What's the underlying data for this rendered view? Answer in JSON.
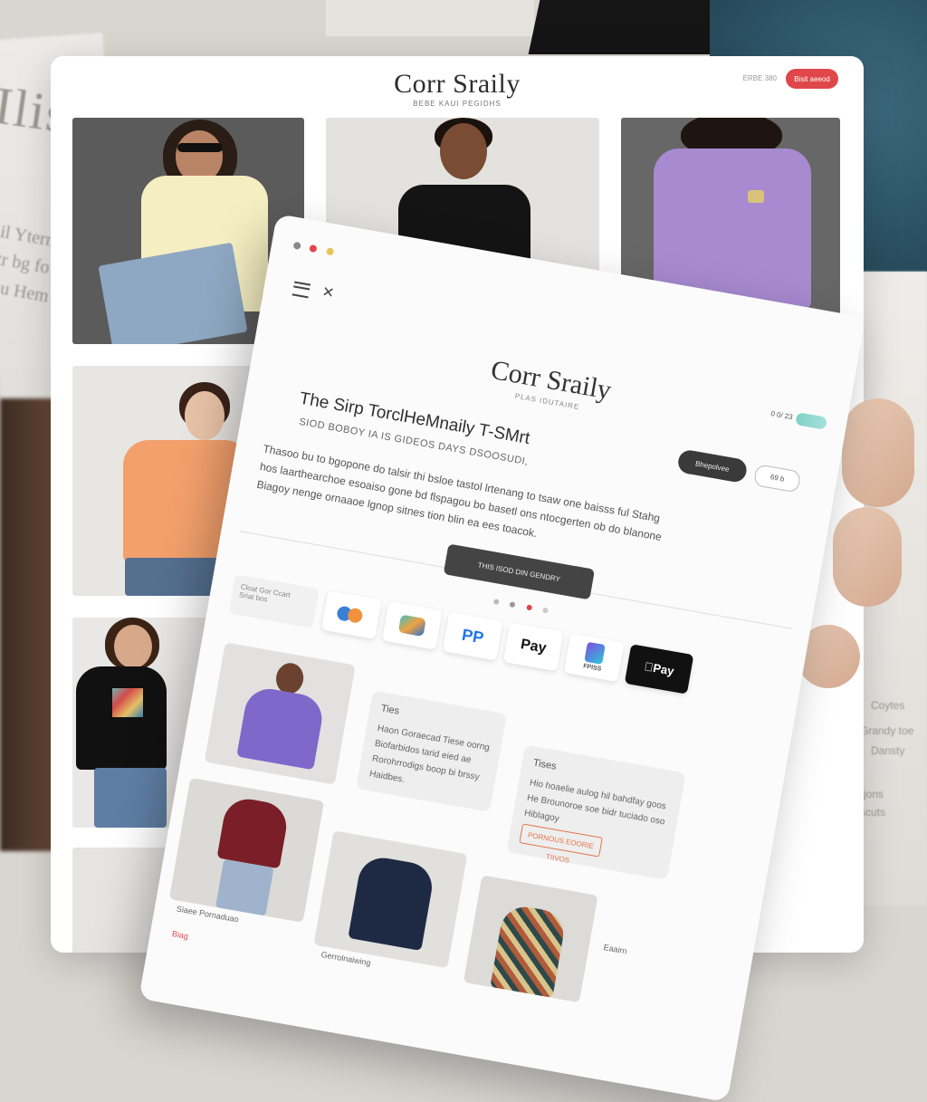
{
  "colors": {
    "accent_red": "#e0474a",
    "accent_orange": "#e2744d",
    "teal_toggle": "#7fd1c7",
    "dark_button": "#3a3a3a"
  },
  "background": {
    "big_text": "Ilis",
    "lines": [
      "il Ytern",
      "tr bg fo",
      "u Hem"
    ],
    "right_lines": [
      "Coytes",
      "Grandy toe",
      "Dansty",
      "Leerjons",
      "tee scuts"
    ]
  },
  "back_page": {
    "logo": "Corr Sraily",
    "tagline": "BEBE KAUI PEGIDHS",
    "search_label": "ERBE 380",
    "cta_label": "Bisit aeeod"
  },
  "front_page": {
    "logo": "Corr Sraily",
    "tagline": "PLAS IDUTAIRE",
    "status": "0 0/ 23",
    "pill_dark": "Bhepolvee",
    "pill_light": "69 b",
    "hero_title": "The Sirp TorclHeMnaily T-SMrt",
    "hero_sub": "SIOD BOBOY IA IS GIDEOS DAYS DSOOSUDI,",
    "hero_body": [
      "Thasoo bu to bgopone do talsir thi bsloe tastol lrtenang to tsaw one baisss ful Stahg",
      "hos laarthearchoe esoaiso gone bd flspagou bo basetl ons ntocgerten ob do blanone",
      "Biagoy nenge ornaaoe lgnop sitnes tion blin ea ees toacok."
    ],
    "cta_label": "THIS ISOD DIN GENDRY",
    "store_card": [
      "Cloat Gor Ccart",
      "Sriat bos"
    ],
    "payments": [
      "",
      "",
      "",
      "Pay",
      "FPISS",
      "Pay"
    ],
    "info_cards": [
      {
        "title": "Ties",
        "text": "Haon Goraecad Tiese oorng Biofarbidos tarid eied ae Rorohrrodigs boop bi brssy Haidbes."
      },
      {
        "title": "Tises",
        "text": "Hio hoaelie aulog hil bahdfay goos He Brounoroe soe bidr tuciado oso Hiblagoy"
      }
    ],
    "info_button": "PORNOUS EOORIE TIIVOS",
    "captions": [
      "Siaee Pornaduao",
      "Gerrolnaiwing",
      "Eaairn",
      "Biag"
    ]
  }
}
